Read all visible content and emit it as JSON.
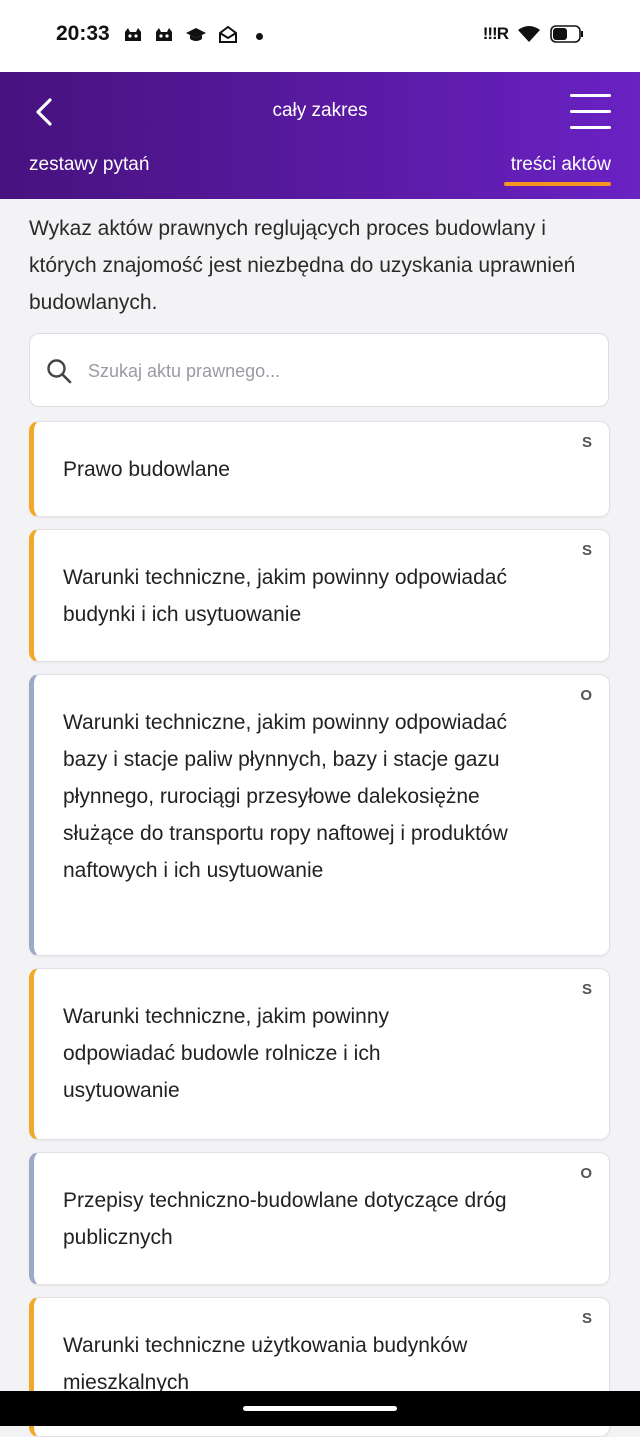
{
  "status_bar": {
    "time": "20:33",
    "network": "!!!R",
    "icons": [
      "cat-icon",
      "cat-icon",
      "graduation-cap-icon",
      "mail-open-icon"
    ]
  },
  "header": {
    "title": "cały zakres",
    "tabs": [
      {
        "label": "zestawy pytań",
        "active": false
      },
      {
        "label": "treści aktów",
        "active": true
      }
    ],
    "accent_color": "#f7941d"
  },
  "intro": "Wykaz aktów prawnych reglujących proces budowlany i których znajomość jest niezbędna do uzyskania uprawnień budowlanych.",
  "search": {
    "placeholder": "Szukaj aktu prawnego...",
    "value": ""
  },
  "acts": [
    {
      "title": "Prawo budowlane",
      "badge": "S",
      "color": "#f2a92a"
    },
    {
      "title": "Warunki techniczne, jakim powinny odpowiadać budynki i ich usytuowanie",
      "badge": "S",
      "color": "#f2a92a"
    },
    {
      "title": "Warunki techniczne, jakim powinny odpowiadać bazy i stacje paliw płynnych, bazy i stacje gazu płynnego, rurociągi przesyłowe dalekosiężne służące do transportu ropy naftowej i produktów naftowych i ich usytuowanie",
      "badge": "O",
      "color": "#9ea9c7"
    },
    {
      "title": "Warunki techniczne, jakim powinny odpowiadać budowle rolnicze i ich usytuowanie",
      "badge": "S",
      "color": "#f2a92a"
    },
    {
      "title": "Przepisy techniczno-budowlane dotyczące dróg publicznych",
      "badge": "O",
      "color": "#9ea9c7"
    },
    {
      "title": "Warunki techniczne użytkowania budynków mieszkalnych",
      "badge": "S",
      "color": "#f2a92a"
    }
  ]
}
